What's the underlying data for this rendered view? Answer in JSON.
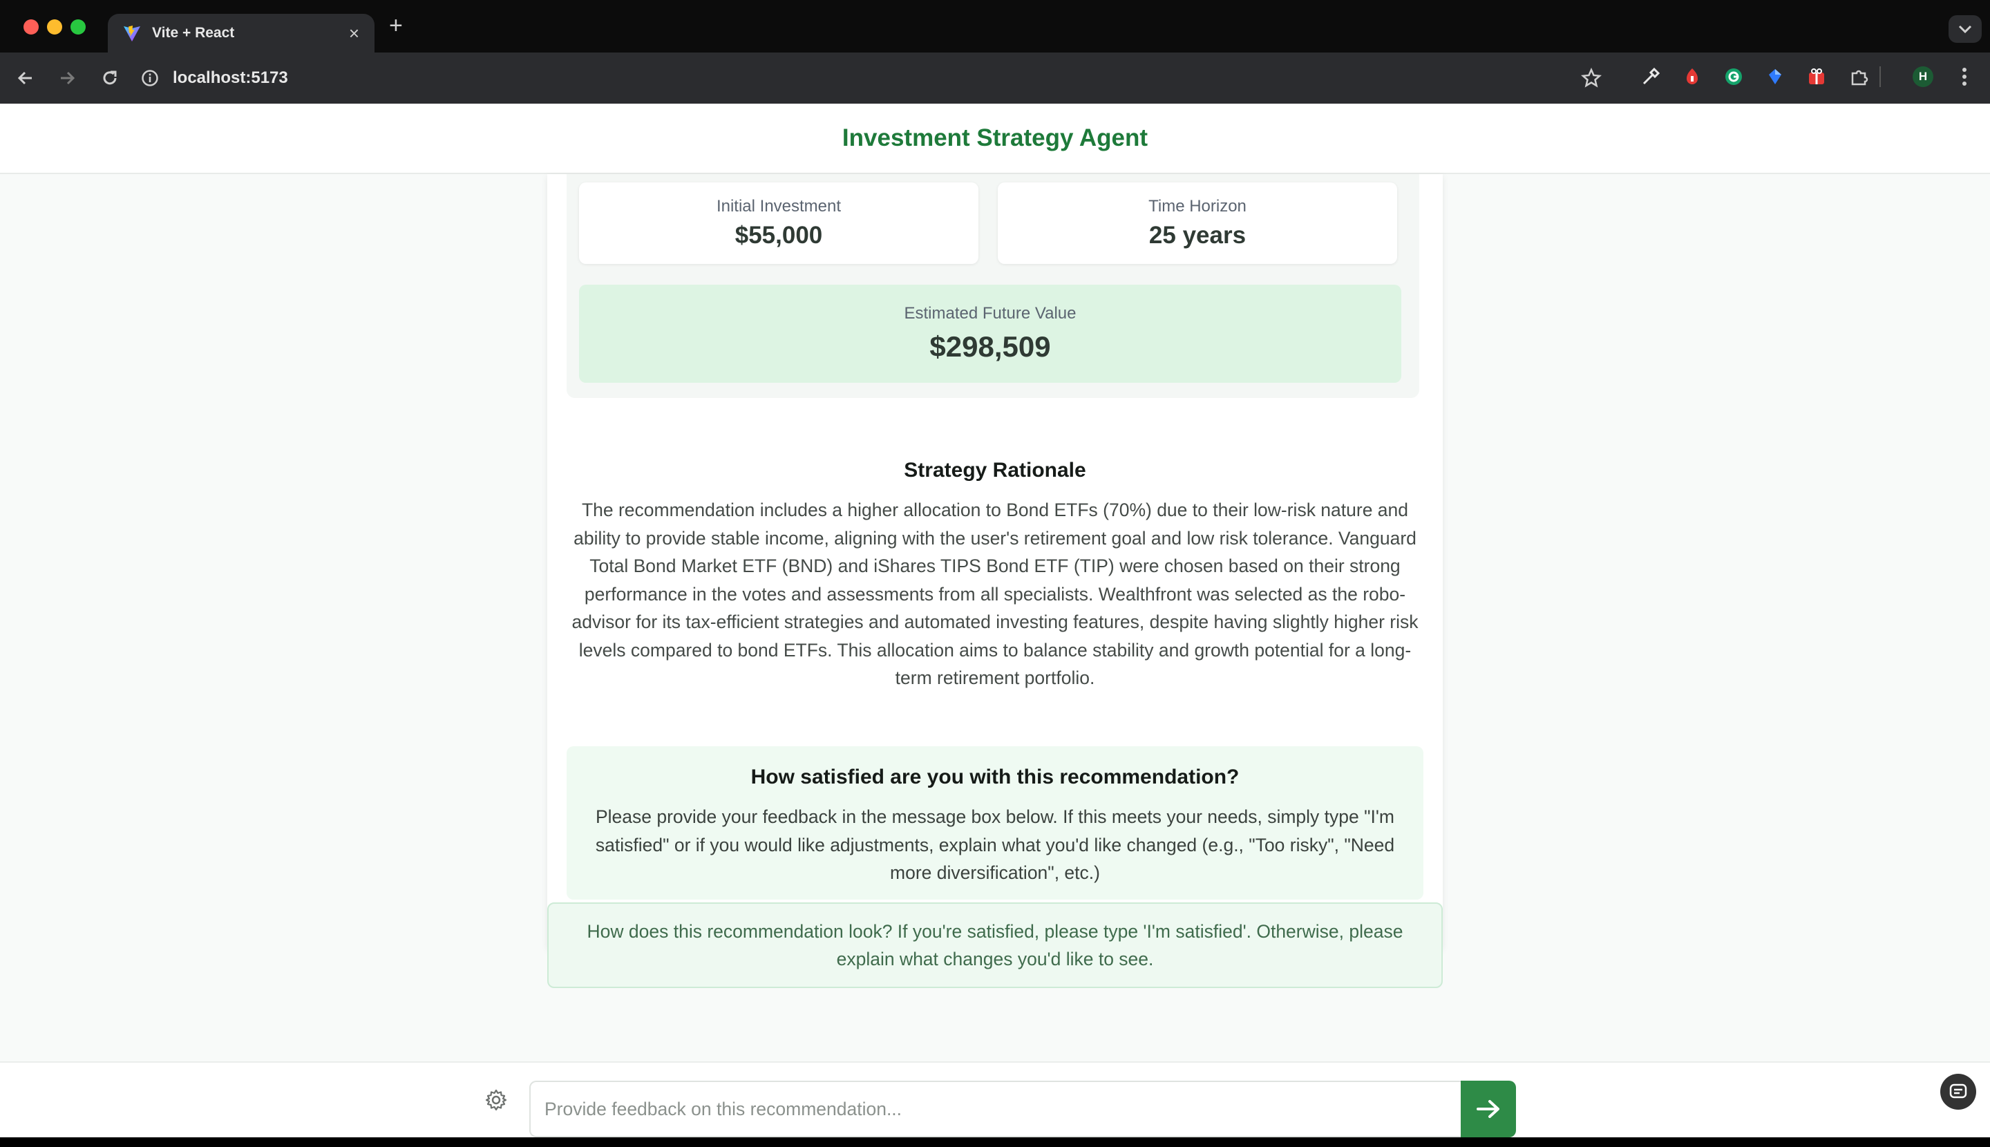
{
  "browser": {
    "tab_title": "Vite + React",
    "url": "localhost:5173",
    "avatar_initial": "H",
    "icons": [
      "back-icon",
      "forward-icon",
      "reload-icon",
      "info-icon",
      "bookmark-star-icon",
      "dropper-icon",
      "extension-red-icon",
      "grammarly-icon",
      "extension-blue-icon",
      "extension-gift-icon",
      "puzzle-icon",
      "profile-icon",
      "kebab-menu-icon"
    ]
  },
  "app": {
    "title": "Investment Strategy Agent",
    "accent_color": "#2e8b47"
  },
  "metrics": {
    "initial_investment_label": "Initial Investment",
    "initial_investment_value": "$55,000",
    "time_horizon_label": "Time Horizon",
    "time_horizon_value": "25 years",
    "future_value_label": "Estimated Future Value",
    "future_value_value": "$298,509"
  },
  "rationale": {
    "title": "Strategy Rationale",
    "text": "The recommendation includes a higher allocation to Bond ETFs (70%) due to their low-risk nature and ability to provide stable income, aligning with the user's retirement goal and low risk tolerance. Vanguard Total Bond Market ETF (BND) and iShares TIPS Bond ETF (TIP) were chosen based on their strong performance in the votes and assessments from all specialists. Wealthfront was selected as the robo-advisor for its tax-efficient strategies and automated investing features, despite having slightly higher risk levels compared to bond ETFs. This allocation aims to balance stability and growth potential for a long-term retirement portfolio."
  },
  "feedback_prompt": {
    "title": "How satisfied are you with this recommendation?",
    "text": "Please provide your feedback in the message box below. If this meets your needs, simply type \"I'm satisfied\" or if you would like adjustments, explain what you'd like changed (e.g., \"Too risky\", \"Need more diversification\", etc.)"
  },
  "agent_message": {
    "text": "How does this recommendation look? If you're satisfied, please type 'I'm satisfied'. Otherwise, please explain what changes you'd like to see."
  },
  "input": {
    "placeholder": "Provide feedback on this recommendation...",
    "value": ""
  }
}
